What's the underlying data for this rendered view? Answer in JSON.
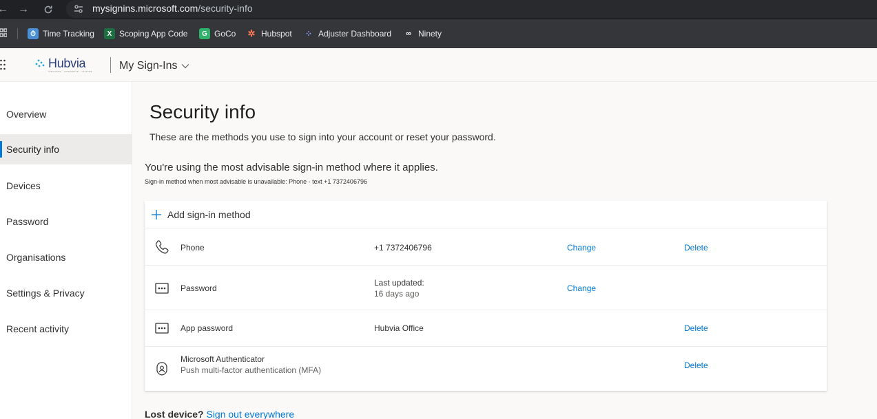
{
  "browser": {
    "url_host": "mysignins.microsoft.com",
    "url_path": "/security-info",
    "bookmarks": [
      {
        "label": "Time Tracking",
        "icon": "clock-icon",
        "color": "#4a90d9"
      },
      {
        "label": "Scoping App Code",
        "icon": "excel-icon",
        "color": "#1d6f42"
      },
      {
        "label": "GoCo",
        "icon": "goco-icon",
        "color": "#2fb36b"
      },
      {
        "label": "Hubspot",
        "icon": "hubspot-icon",
        "color": "#ff7a59"
      },
      {
        "label": "Adjuster Dashboard",
        "icon": "dots-icon",
        "color": "#6b7cff"
      },
      {
        "label": "Ninety",
        "icon": "ninety-icon",
        "color": "#ffffff"
      }
    ]
  },
  "header": {
    "logo_text": "Hubvia",
    "logo_tagline": "INNOVATE · INTEGRATE · INSPIRE",
    "app_title": "My Sign-Ins"
  },
  "sidebar": {
    "items": [
      {
        "label": "Overview",
        "active": false
      },
      {
        "label": "Security info",
        "active": true
      },
      {
        "label": "Devices",
        "active": false
      },
      {
        "label": "Password",
        "active": false
      },
      {
        "label": "Organisations",
        "active": false
      },
      {
        "label": "Settings & Privacy",
        "active": false
      },
      {
        "label": "Recent activity",
        "active": false
      }
    ]
  },
  "main": {
    "title": "Security info",
    "description": "These are the methods you use to sign into your account or reset your password.",
    "advisable": "You're using the most advisable sign-in method where it applies.",
    "advisable_sub": "Sign-in method when most advisable is unavailable: Phone - text +1 7372406796",
    "add_method_label": "Add sign-in method",
    "methods": [
      {
        "name": "Phone",
        "icon": "phone-icon",
        "detail": "+1 7372406796",
        "change": "Change",
        "delete": "Delete"
      },
      {
        "name": "Password",
        "icon": "password-icon",
        "detail": "Last updated:",
        "detail2": "16 days ago",
        "change": "Change"
      },
      {
        "name": "App password",
        "icon": "password-icon",
        "detail": "Hubvia Office",
        "delete": "Delete"
      },
      {
        "name": "Microsoft Authenticator",
        "sub": "Push multi-factor authentication (MFA)",
        "icon": "authenticator-icon",
        "delete": "Delete"
      }
    ],
    "lost_device_label": "Lost device?",
    "sign_out_link": "Sign out everywhere"
  },
  "colors": {
    "accent": "#0078d4",
    "active_nav_bg": "#edebe9"
  }
}
